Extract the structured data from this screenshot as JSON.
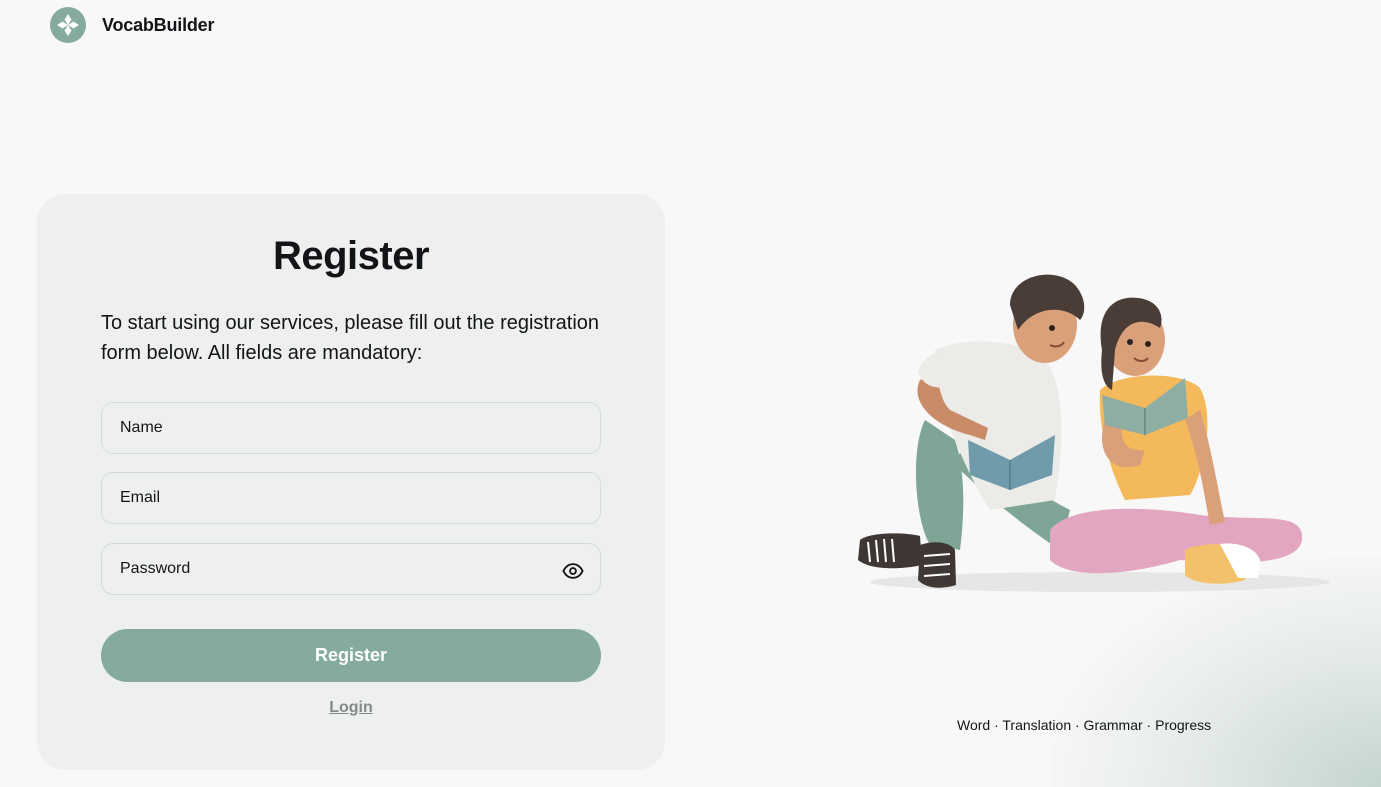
{
  "header": {
    "brand": "VocabBuilder",
    "logo_icon": "clover-logo-icon"
  },
  "form": {
    "title": "Register",
    "description": "To start using our services, please fill out the registration form below. All fields are mandatory:",
    "name_placeholder": "Name",
    "email_placeholder": "Email",
    "password_placeholder": "Password",
    "password_toggle_icon": "eye-icon",
    "submit_label": "Register",
    "login_label": "Login"
  },
  "hero": {
    "tagline": "Word · Translation · Grammar · Progress",
    "illustration": "two-students-reading-books"
  },
  "colors": {
    "accent": "#85aa9f",
    "background": "#f8f8f8",
    "card": "#eef0ef",
    "text": "#121417"
  }
}
